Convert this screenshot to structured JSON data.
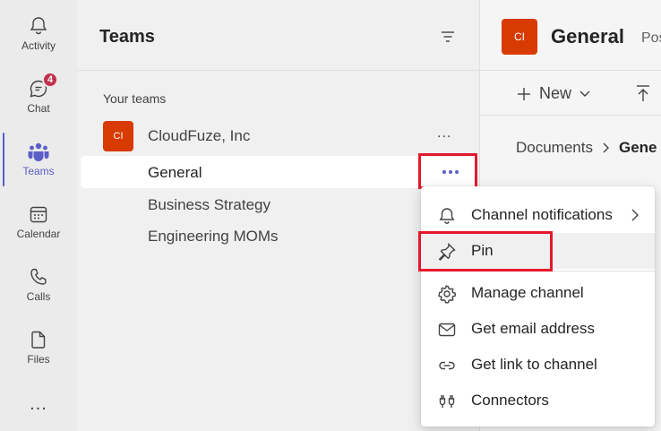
{
  "rail": {
    "activity_label": "Activity",
    "chat_label": "Chat",
    "chat_badge": "4",
    "teams_label": "Teams",
    "calendar_label": "Calendar",
    "calls_label": "Calls",
    "files_label": "Files",
    "more_label": "..."
  },
  "panel": {
    "title": "Teams",
    "section_label": "Your teams",
    "team": {
      "avatar_text": "CI",
      "name": "CloudFuze, Inc",
      "more": "..."
    },
    "channels": [
      {
        "name": "General"
      },
      {
        "name": "Business Strategy"
      },
      {
        "name": "Engineering MOMs"
      }
    ]
  },
  "main": {
    "avatar_text": "CI",
    "title": "General",
    "tab_partial": "Pos",
    "new_label": "New",
    "breadcrumb_root": "Documents",
    "breadcrumb_current": "Gene"
  },
  "menu": {
    "items": [
      {
        "label": "Channel notifications",
        "icon": "bell-icon"
      },
      {
        "label": "Pin",
        "icon": "pin-icon"
      },
      {
        "label": "Manage channel",
        "icon": "gear-icon"
      },
      {
        "label": "Get email address",
        "icon": "mail-icon"
      },
      {
        "label": "Get link to channel",
        "icon": "link-icon"
      },
      {
        "label": "Connectors",
        "icon": "connectors-icon"
      }
    ]
  },
  "colors": {
    "accent": "#5b5fc7",
    "avatar": "#d83b01",
    "highlight": "#e3182d",
    "badge": "#c4314b"
  }
}
